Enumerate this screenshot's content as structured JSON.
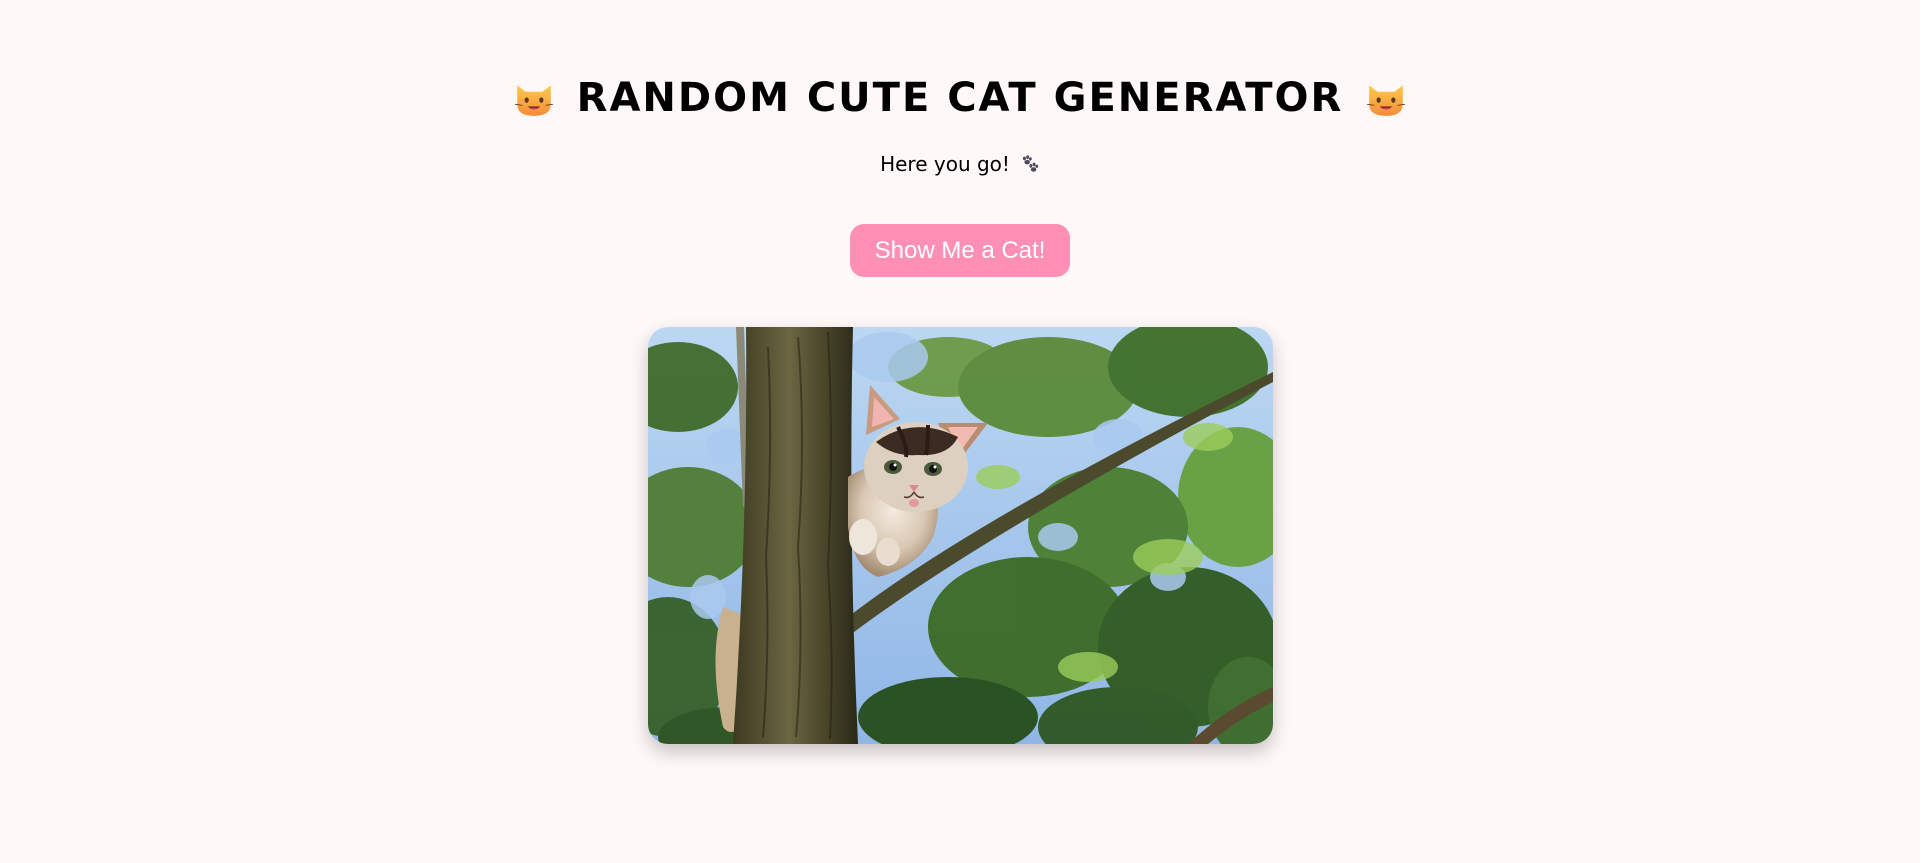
{
  "header": {
    "title": "RANDOM CUTE CAT GENERATOR",
    "left_icon": "cat-face-icon",
    "right_icon": "cat-face-icon"
  },
  "status": {
    "message": "Here you go!",
    "icon": "paw-prints-icon"
  },
  "actions": {
    "show_cat_label": "Show Me a Cat!"
  },
  "colors": {
    "background": "#fff8f8",
    "button": "#ff8fb4",
    "button_text": "#ffffff"
  },
  "image": {
    "subject": "kitten-in-tree"
  }
}
